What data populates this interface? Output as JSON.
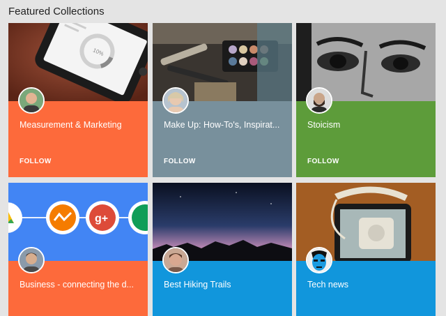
{
  "section": {
    "title": "Featured Collections"
  },
  "cards": [
    {
      "title": "Measurement & Marketing",
      "follow": "FOLLOW",
      "color": "#fd6a3b"
    },
    {
      "title": "Make Up: How-To's, Inspirat...",
      "follow": "FOLLOW",
      "color": "#78909c"
    },
    {
      "title": "Stoicism",
      "follow": "FOLLOW",
      "color": "#5d9c3a"
    },
    {
      "title": "Business - connecting the d...",
      "color": "#fd6a3b"
    },
    {
      "title": "Best Hiking Trails",
      "color": "#1196dc"
    },
    {
      "title": "Tech news",
      "color": "#1196dc"
    }
  ],
  "phone_screen": {
    "stat": "10%"
  }
}
